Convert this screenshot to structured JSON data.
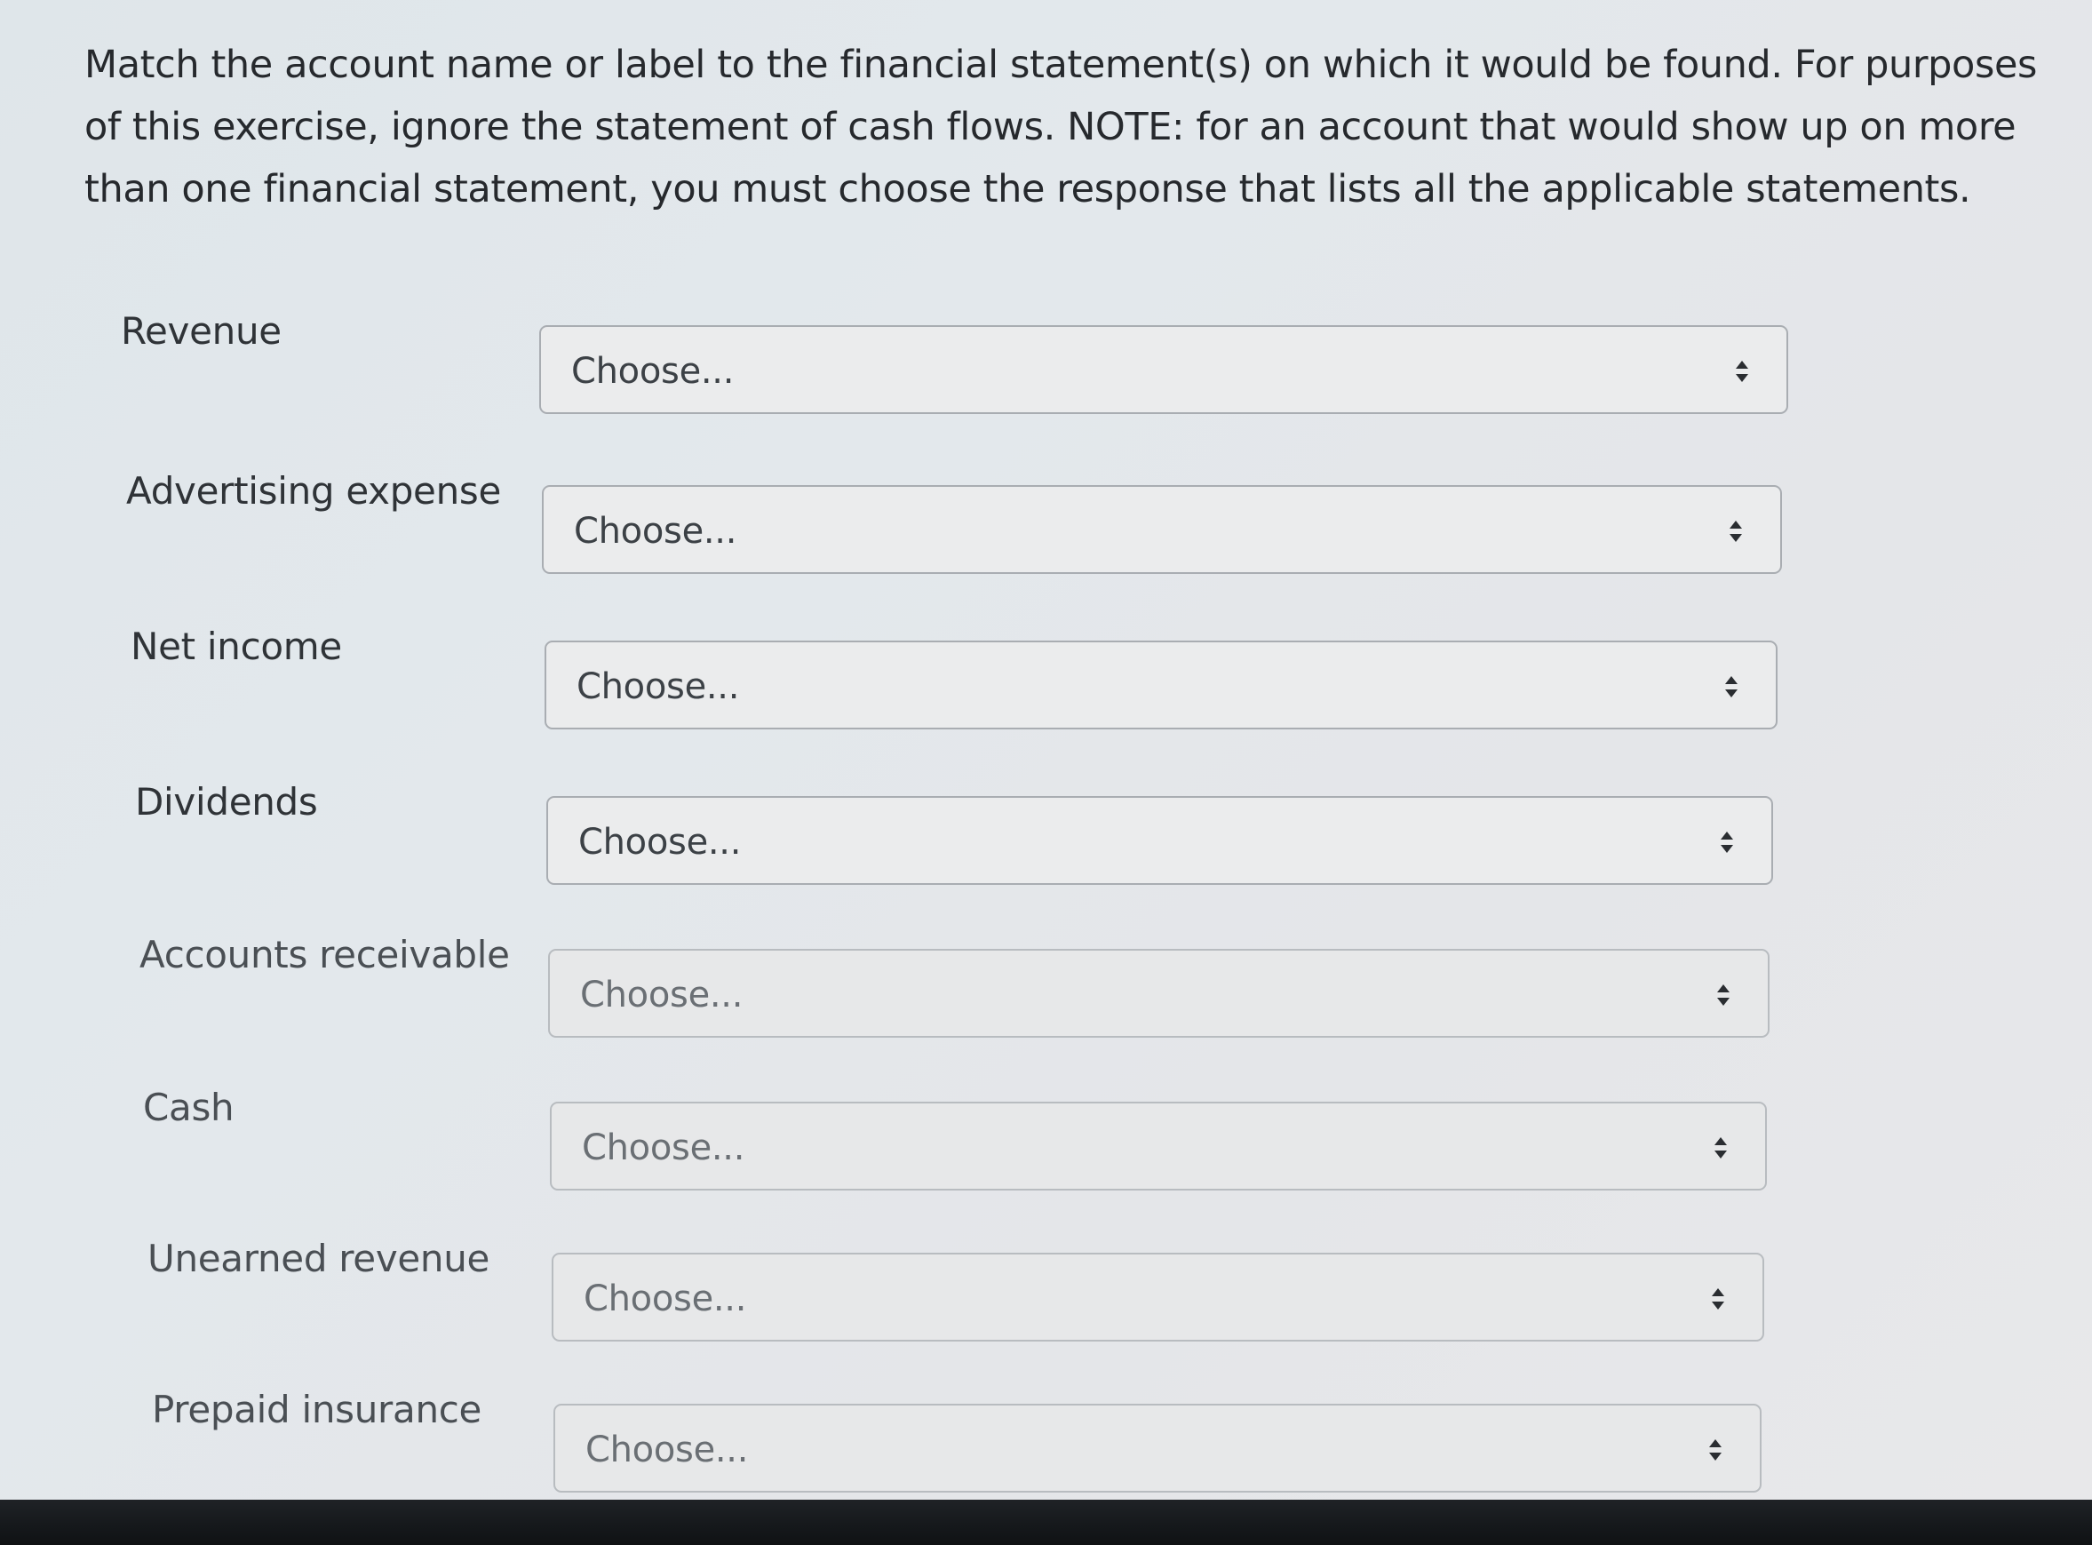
{
  "instructions": "Match the account name or label to the financial statement(s) on which it would be found. For purposes of this exercise, ignore the statement of cash flows. NOTE: for an account that would show up on more than one financial statement, you must choose the response that lists all the applicable statements.",
  "questions": [
    {
      "account": "Revenue",
      "selected": "Choose..."
    },
    {
      "account": "Advertising expense",
      "selected": "Choose..."
    },
    {
      "account": "Net income",
      "selected": "Choose..."
    },
    {
      "account": "Dividends",
      "selected": "Choose..."
    },
    {
      "account": "Accounts receivable",
      "selected": "Choose..."
    },
    {
      "account": "Cash",
      "selected": "Choose..."
    },
    {
      "account": "Unearned revenue",
      "selected": "Choose..."
    },
    {
      "account": "Prepaid insurance",
      "selected": "Choose..."
    }
  ],
  "icons": {
    "select_arrow": "sort-updown-icon"
  }
}
